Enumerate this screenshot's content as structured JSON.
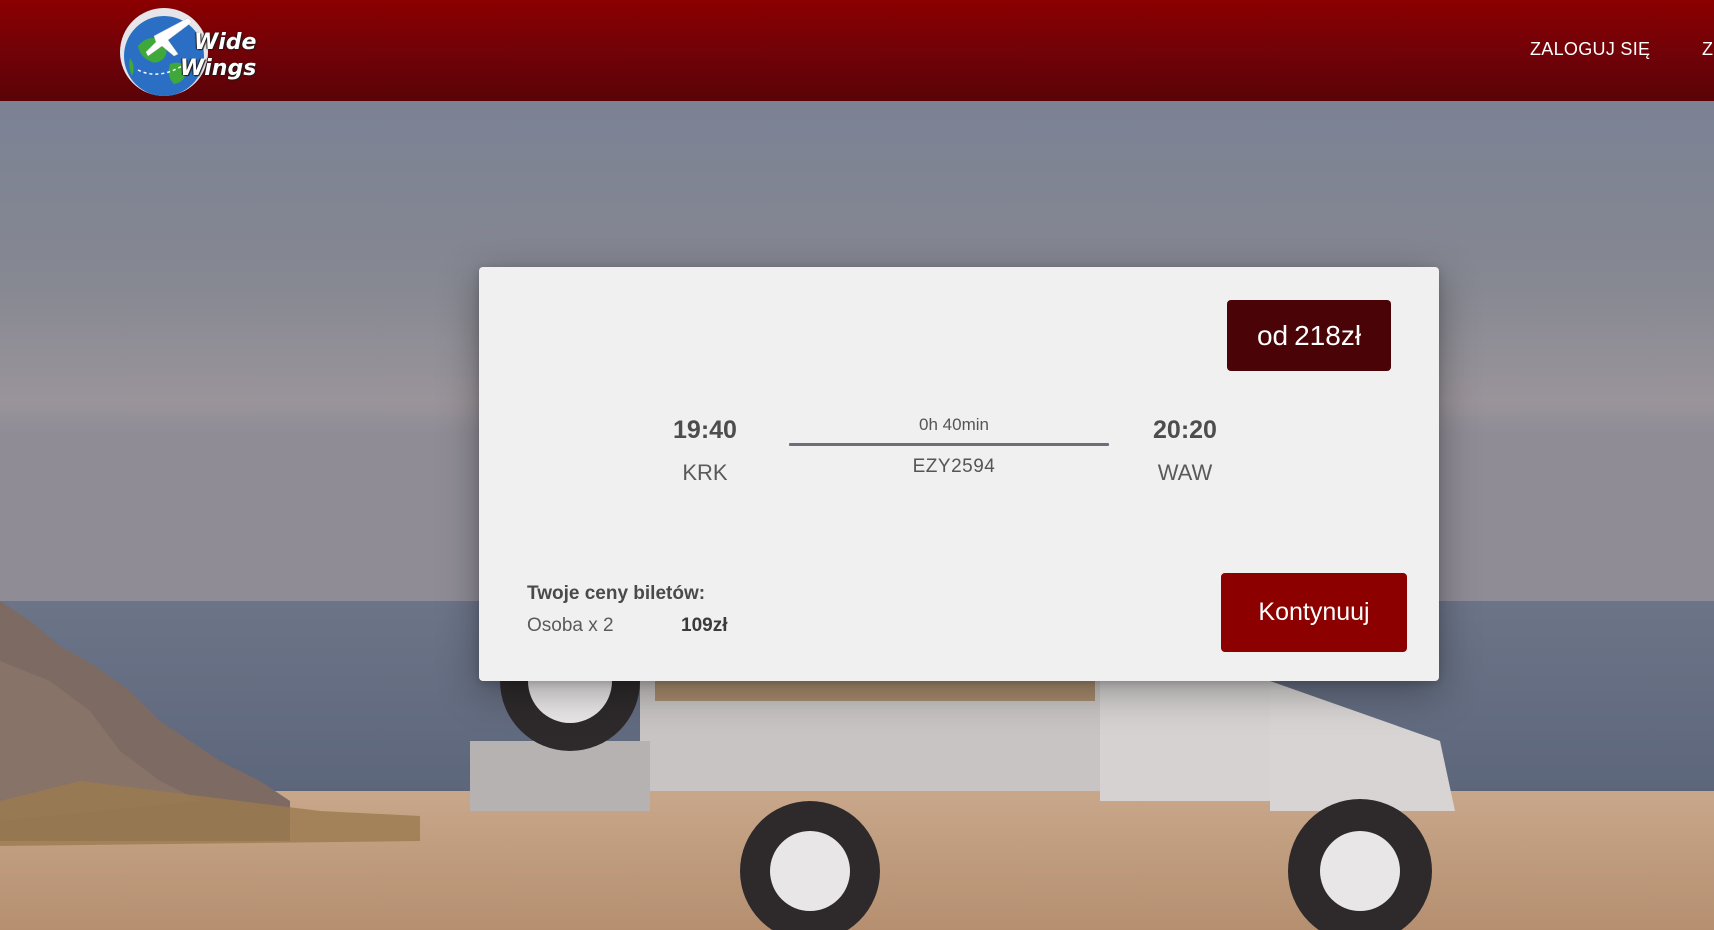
{
  "header": {
    "logo": {
      "line1": "Wide",
      "line2": "Wings"
    },
    "nav": {
      "login": "ZALOGUJ SIĘ",
      "register": "Z"
    }
  },
  "card": {
    "price_badge": {
      "prefix": "od",
      "amount": "218zł"
    },
    "departure": {
      "time": "19:40",
      "code": "KRK"
    },
    "arrival": {
      "time": "20:20",
      "code": "WAW"
    },
    "duration": "0h 40min",
    "flight_number": "EZY2594",
    "prices_title": "Twoje ceny biletów:",
    "person_label": "Osoba x 2",
    "person_price": "109zł",
    "continue_label": "Kontynuuj"
  },
  "colors": {
    "header": "#8b0000",
    "badge": "#4a0306",
    "button": "#8c0000",
    "card": "#f1f0f1"
  }
}
